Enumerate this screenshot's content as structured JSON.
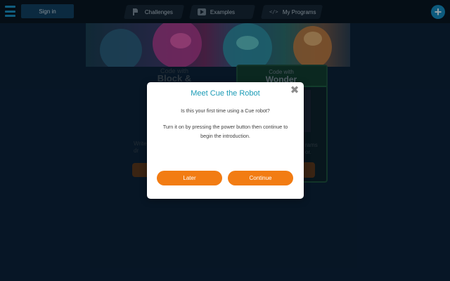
{
  "topbar": {
    "signin_label": "Sign in",
    "tabs": [
      {
        "label": "Challenges",
        "icon": "flag-icon"
      },
      {
        "label": "Examples",
        "icon": "play-icon"
      },
      {
        "label": "My Programs",
        "icon": "code-icon"
      }
    ],
    "code_icon_glyph": "</>",
    "plus_glyph": "+"
  },
  "background": {
    "left_panel": {
      "small": "Code with",
      "big": "Block & JavaScript",
      "superscript": "®",
      "desc_fragment_1": "Write",
      "desc_fragment_2": "dr"
    },
    "right_panel": {
      "small": "Code with",
      "big": "Wonder",
      "desc_fragment_1": "rams",
      "desc_fragment_2": "or."
    }
  },
  "modal": {
    "title": "Meet Cue the Robot",
    "close_glyph": "✖",
    "question": "Is this your first time using a Cue robot?",
    "body": "Turn it on by pressing the power button then continue to begin the introduction.",
    "later_label": "Later",
    "continue_label": "Continue"
  },
  "colors": {
    "accent_orange": "#f27c13",
    "title_teal": "#1b9bb6",
    "topbar_bg": "#09121a",
    "page_bg": "#0b1e30"
  }
}
